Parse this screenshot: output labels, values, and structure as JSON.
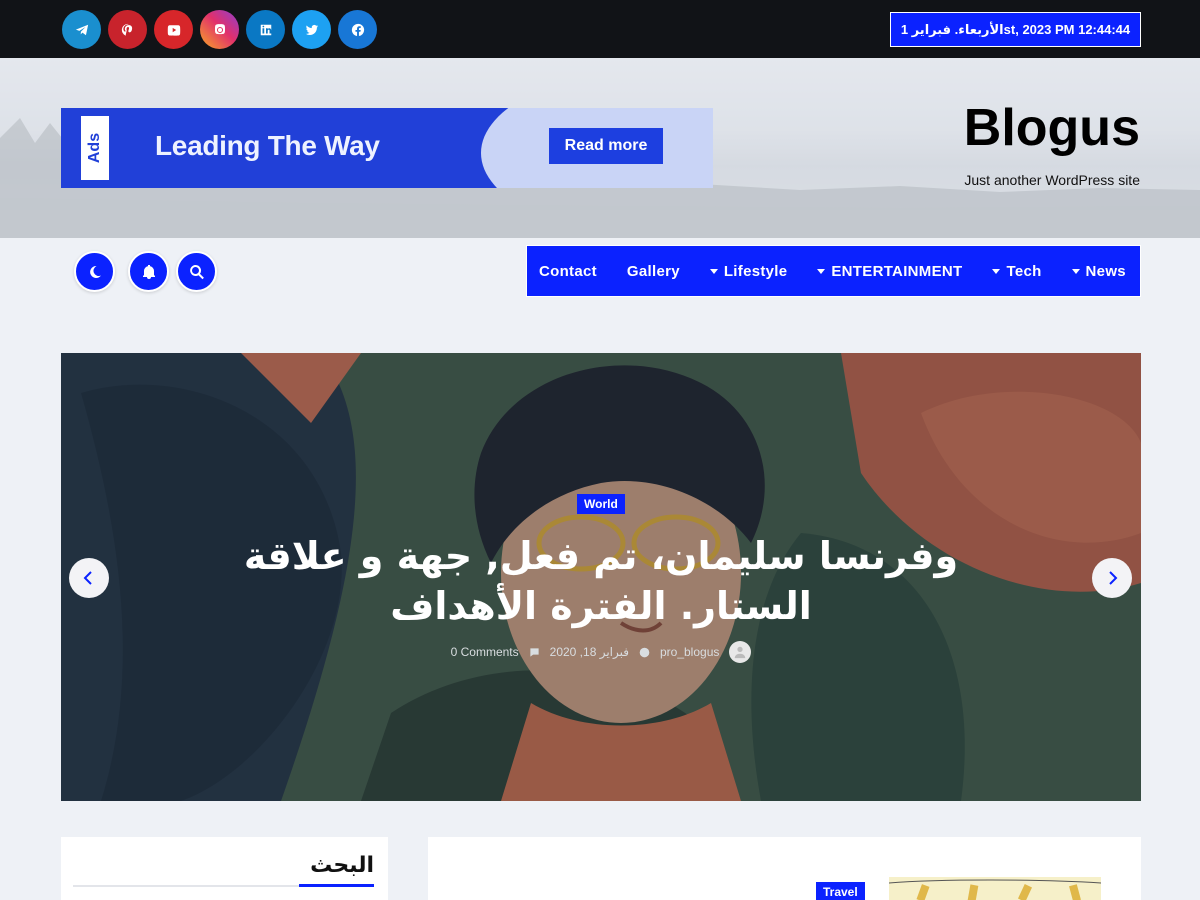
{
  "topbar": {
    "socials": [
      {
        "name": "telegram-icon",
        "color": "#1a8fcf"
      },
      {
        "name": "pinterest-icon",
        "color": "#c8232c"
      },
      {
        "name": "youtube-icon",
        "color": "#d7262a"
      },
      {
        "name": "instagram-icon",
        "color": "#e1306c"
      },
      {
        "name": "linkedin-icon",
        "color": "#0a78c4"
      },
      {
        "name": "twitter-icon",
        "color": "#1da1f2"
      },
      {
        "name": "facebook-icon",
        "color": "#1877d6"
      }
    ],
    "datetime": "الأربعاء. فبراير 1st, 2023 PM 12:44:44"
  },
  "header": {
    "ad": {
      "tag": "Ads",
      "headline": "Leading The Way",
      "button": "Read more"
    },
    "site_title": "Blogus",
    "tagline": "Just another WordPress site"
  },
  "nav": {
    "items": [
      {
        "label": "Contact",
        "dropdown": false
      },
      {
        "label": "Gallery",
        "dropdown": false
      },
      {
        "label": "Lifestyle",
        "dropdown": true
      },
      {
        "label": "ENTERTAINMENT",
        "dropdown": true
      },
      {
        "label": "Tech",
        "dropdown": true
      },
      {
        "label": "News",
        "dropdown": true
      }
    ]
  },
  "slider": {
    "category": "World",
    "title": "وفرنسا سليمان، تم فعل, جهة و علاقة الستار. الفترة الأهداف",
    "author": "pro_blogus",
    "date": "فبراير 18, 2020",
    "comments": "0 Comments"
  },
  "sidebar": {
    "search_heading": "البحث"
  },
  "post": {
    "category": "Travel"
  },
  "colors": {
    "accent": "#0b22ff",
    "topbar": "#111317"
  }
}
